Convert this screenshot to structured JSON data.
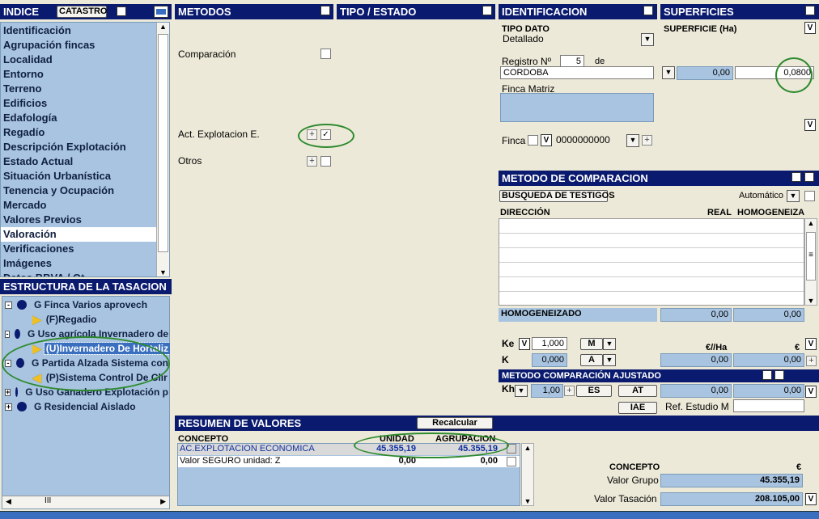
{
  "indice": {
    "title": "INDICE",
    "catastro_label": "CATASTRO",
    "items": [
      {
        "label": "Identificación"
      },
      {
        "label": "Agrupación fincas"
      },
      {
        "label": "Localidad"
      },
      {
        "label": "Entorno"
      },
      {
        "label": "Terreno"
      },
      {
        "label": "Edificios"
      },
      {
        "label": "Edafología"
      },
      {
        "label": "Regadío"
      },
      {
        "label": "Descripción Explotación"
      },
      {
        "label": "Estado Actual"
      },
      {
        "label": "Situación Urbanística"
      },
      {
        "label": "Tenencia y Ocupación"
      },
      {
        "label": "Mercado"
      },
      {
        "label": "Valores Previos"
      },
      {
        "label": "Valoración"
      },
      {
        "label": "Verificaciones"
      },
      {
        "label": "Imágenes"
      },
      {
        "label": "Datos BBVA / Ot"
      }
    ],
    "selected": "Valoración"
  },
  "estructura": {
    "title": "ESTRUCTURA DE LA TASACION",
    "nodes": [
      {
        "text": "G Finca Varios aprovech"
      },
      {
        "text": "(F)Regadio"
      },
      {
        "text": "G Uso agrícola Invernadero de"
      },
      {
        "text": "(U)Invernadero De Hortaliz"
      },
      {
        "text": "G Partida Alzada Sistema con"
      },
      {
        "text": "(P)Sistema Control De Clir"
      },
      {
        "text": "G Uso Ganadero Explotación p"
      },
      {
        "text": "G Residencial Aislado"
      }
    ],
    "scroll_label": "III"
  },
  "metodos": {
    "title": "METODOS",
    "comparacion": "Comparación",
    "act_explotacion": "Act. Explotacion E.",
    "otros": "Otros"
  },
  "tipo_estado": {
    "title": "TIPO / ESTADO"
  },
  "identificacion": {
    "title": "IDENTIFICACION",
    "tipo_dato_label": "TIPO DATO",
    "tipo_dato_value": "Detallado",
    "registro_label": "Registro Nº",
    "registro_value": "5",
    "de_label": "de",
    "registro_city": "CORDOBA",
    "finca_matriz_label": "Finca Matriz",
    "finca_label": "Finca",
    "finca_v": "V",
    "finca_value": "0000000000"
  },
  "superficies": {
    "title": "SUPERFICIES",
    "superficie_label": "SUPERFICIE (Ha)",
    "v_label": "V",
    "val1": "0,00",
    "val2": "0,0800"
  },
  "metodo_comparacion": {
    "title": "METODO DE COMPARACION",
    "busqueda_label": "BUSQUEDA DE TESTIGOS",
    "modo": "Automático",
    "col_direccion": "DIRECCIÓN",
    "col_real": "REAL",
    "col_homogeneiza": "HOMOGENEIZA",
    "homogeneizado_label": "HOMOGENEIZADO",
    "homog_v1": "0,00",
    "homog_v2": "0,00",
    "ke_label": "Ke",
    "ke_v": "V",
    "ke_value": "1,000",
    "m_label": "M",
    "eur_ha_label": "€//Ha",
    "eur_label": "€",
    "k_label": "K",
    "k_value": "0,000",
    "a_label": "A",
    "k_v1": "0,00",
    "k_v2": "0,00"
  },
  "metodo_ajustado": {
    "title": "METODO COMPARACIÓN AJUSTADO",
    "kh_label": "Kh",
    "kh_value": "1,00",
    "es_label": "ES",
    "at_label": "AT",
    "v1": "0,00",
    "v2": "0,00",
    "iae_label": "IAE",
    "ref_label": "Ref. Estudio M"
  },
  "resumen": {
    "title": "RESUMEN DE VALORES",
    "recalcular_label": "Recalcular",
    "col_concepto": "CONCEPTO",
    "col_unidad": "UNIDAD",
    "col_agrupacion": "AGRUPACION",
    "rows": [
      {
        "concepto": "AC.EXPLOTACION ECONOMICA",
        "unidad": "45.355,19",
        "agrupacion": "45.355,19"
      },
      {
        "concepto": "Valor SEGURO unidad: Z",
        "unidad": "0,00",
        "agrupacion": "0,00"
      }
    ],
    "concepto_label": "CONCEPTO",
    "euro_label": "€",
    "valor_grupo_label": "Valor Grupo",
    "valor_grupo": "45.355,19",
    "valor_tasacion_label": "Valor Tasación",
    "valor_tasacion": "208.105,00",
    "v_label": "V"
  },
  "colors": {
    "header": "#0a1a6e",
    "panel": "#a8c4e0",
    "highlight": "#2e8a2e"
  }
}
